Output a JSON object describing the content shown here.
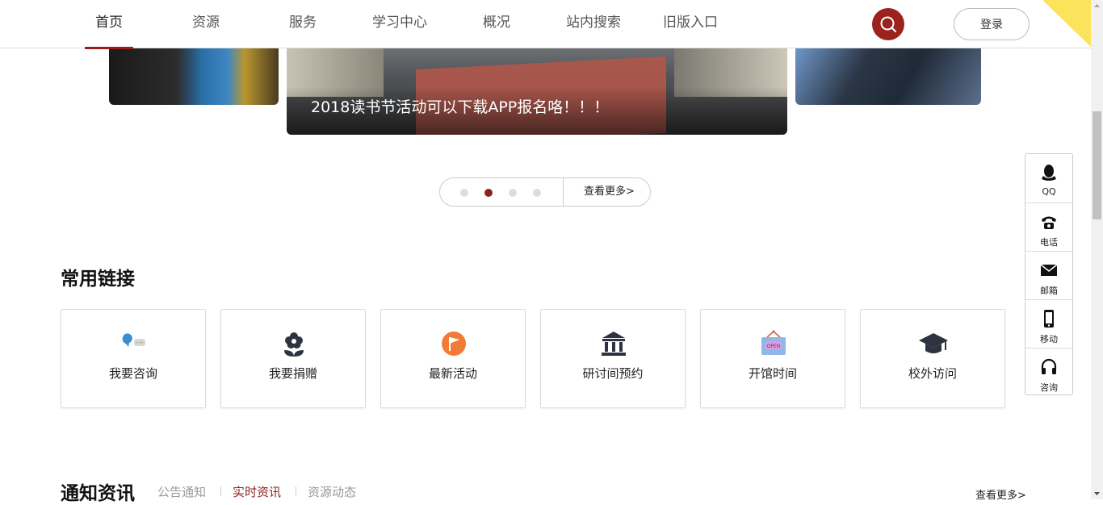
{
  "nav": {
    "items": [
      "首页",
      "资源",
      "服务",
      "学习中心",
      "概况",
      "站内搜索",
      "旧版入口"
    ],
    "active_index": 0,
    "login_label": "登录"
  },
  "carousel": {
    "caption": "2018读书节活动可以下载APP报名咯！！！",
    "active_dot": 1,
    "dot_count": 4,
    "more_label": "查看更多>"
  },
  "links": {
    "title": "常用链接",
    "items": [
      {
        "label": "我要咨询",
        "icon": "consult-icon"
      },
      {
        "label": "我要捐赠",
        "icon": "donate-flower-icon"
      },
      {
        "label": "最新活动",
        "icon": "flag-icon"
      },
      {
        "label": "研讨间预约",
        "icon": "library-building-icon"
      },
      {
        "label": "开馆时间",
        "icon": "open-sign-icon"
      },
      {
        "label": "校外访问",
        "icon": "graduation-cap-icon"
      }
    ]
  },
  "news": {
    "title": "通知资讯",
    "tabs": [
      "公告通知",
      "实时资讯",
      "资源动态"
    ],
    "active_tab": 1,
    "more_label": "查看更多>"
  },
  "float_bar": {
    "items": [
      {
        "label": "QQ",
        "icon": "qq-penguin-icon"
      },
      {
        "label": "电话",
        "icon": "phone-icon"
      },
      {
        "label": "邮箱",
        "icon": "mail-icon"
      },
      {
        "label": "移动",
        "icon": "mobile-icon"
      },
      {
        "label": "咨询",
        "icon": "headset-icon"
      }
    ]
  },
  "colors": {
    "brand": "#9a2320",
    "corner": "#fbe35b"
  }
}
